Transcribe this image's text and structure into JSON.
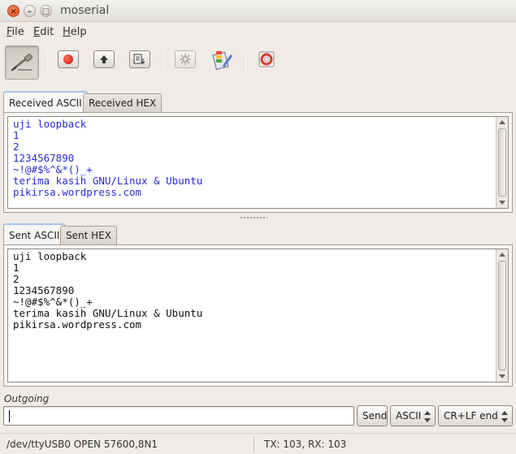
{
  "window": {
    "title": "moserial"
  },
  "menu": [
    {
      "label": "File",
      "mnemonic": "F",
      "rest": "ile"
    },
    {
      "label": "Edit",
      "mnemonic": "E",
      "rest": "dit"
    },
    {
      "label": "Help",
      "mnemonic": "H",
      "rest": "elp"
    }
  ],
  "toolbar": {
    "icons": [
      "connect-icon",
      "record-icon",
      "upload-icon",
      "send-file-icon",
      "settings-icon",
      "preferences-icon",
      "help-icon"
    ]
  },
  "received": {
    "tabs": [
      "Received ASCII",
      "Received HEX"
    ],
    "active_tab": "Received ASCII",
    "lines": [
      "uji loopback",
      "1",
      "2",
      "1234567890",
      "~!@#$%^&*()_+",
      "terima kasih GNU/Linux & Ubuntu",
      "pikirsa.wordpress.com"
    ],
    "text_color": "#2a2ad8"
  },
  "sent": {
    "tabs": [
      "Sent ASCII",
      "Sent HEX"
    ],
    "active_tab": "Sent ASCII",
    "lines": [
      "uji loopback",
      "1",
      "2",
      "1234567890",
      "~!@#$%^&*()_+",
      "terima kasih GNU/Linux & Ubuntu",
      "pikirsa.wordpress.com"
    ]
  },
  "outgoing": {
    "label": "Outgoing",
    "value": "",
    "send_label": "Send",
    "format": "ASCII",
    "line_end": "CR+LF end"
  },
  "status": {
    "port": "/dev/ttyUSB0 OPEN 57600,8N1",
    "counts": "TX: 103, RX: 103"
  },
  "watermark": "pikirsa.wordpress.com"
}
